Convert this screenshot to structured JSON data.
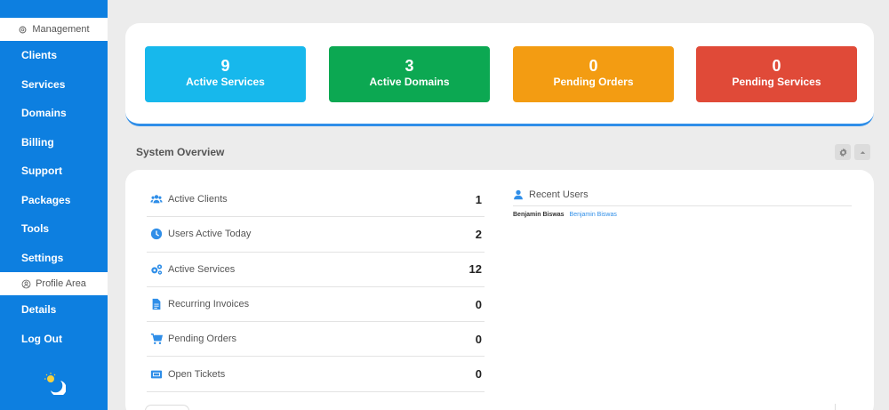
{
  "sidebar": {
    "management_header": "Management",
    "items": [
      {
        "label": "Clients"
      },
      {
        "label": "Services"
      },
      {
        "label": "Domains"
      },
      {
        "label": "Billing"
      },
      {
        "label": "Support"
      },
      {
        "label": "Packages"
      },
      {
        "label": "Tools"
      },
      {
        "label": "Settings"
      }
    ],
    "profile_header": "Profile Area",
    "profile_items": [
      {
        "label": "Details"
      },
      {
        "label": "Log Out"
      }
    ],
    "theme_icon": "moon-sun-icon"
  },
  "stats": [
    {
      "value": "9",
      "label": "Active Services",
      "color": "#17b8ec"
    },
    {
      "value": "3",
      "label": "Active Domains",
      "color": "#0ca852"
    },
    {
      "value": "0",
      "label": "Pending Orders",
      "color": "#f39c12"
    },
    {
      "value": "0",
      "label": "Pending Services",
      "color": "#e04a38"
    }
  ],
  "overview": {
    "title": "System Overview",
    "rows": [
      {
        "label": "Active Clients",
        "value": "1",
        "icon": "users-icon"
      },
      {
        "label": "Users Active Today",
        "value": "2",
        "icon": "clock-icon"
      },
      {
        "label": "Active Services",
        "value": "12",
        "icon": "cogs-icon"
      },
      {
        "label": "Recurring Invoices",
        "value": "0",
        "icon": "file-icon"
      },
      {
        "label": "Pending Orders",
        "value": "0",
        "icon": "cart-icon"
      },
      {
        "label": "Open Tickets",
        "value": "0",
        "icon": "ticket-icon"
      }
    ],
    "recent_users_title": "Recent Users",
    "recent_users": [
      {
        "name": "Benjamin Biswas",
        "link": "Benjamin Biswas"
      }
    ]
  },
  "colors": {
    "sidebar": "#0d7fe0",
    "accent": "#2f8ee8"
  }
}
